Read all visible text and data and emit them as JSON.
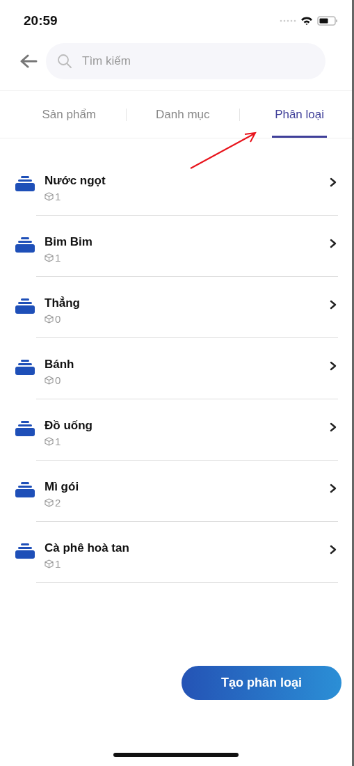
{
  "status_bar": {
    "time": "20:59"
  },
  "search": {
    "placeholder": "Tìm kiếm"
  },
  "tabs": [
    {
      "label": "Sản phẩm",
      "selected": false
    },
    {
      "label": "Danh mục",
      "selected": false
    },
    {
      "label": "Phân loại",
      "selected": true
    }
  ],
  "items": [
    {
      "name": "Nước ngọt",
      "count": "1"
    },
    {
      "name": "Bim Bim",
      "count": "1"
    },
    {
      "name": "Thẳng",
      "count": "0"
    },
    {
      "name": "Bánh",
      "count": "0"
    },
    {
      "name": "Đồ uống",
      "count": "1"
    },
    {
      "name": "Mì gói",
      "count": "2"
    },
    {
      "name": "Cà phê hoà tan",
      "count": "1"
    }
  ],
  "button": {
    "label": "Tạo phân loại"
  }
}
